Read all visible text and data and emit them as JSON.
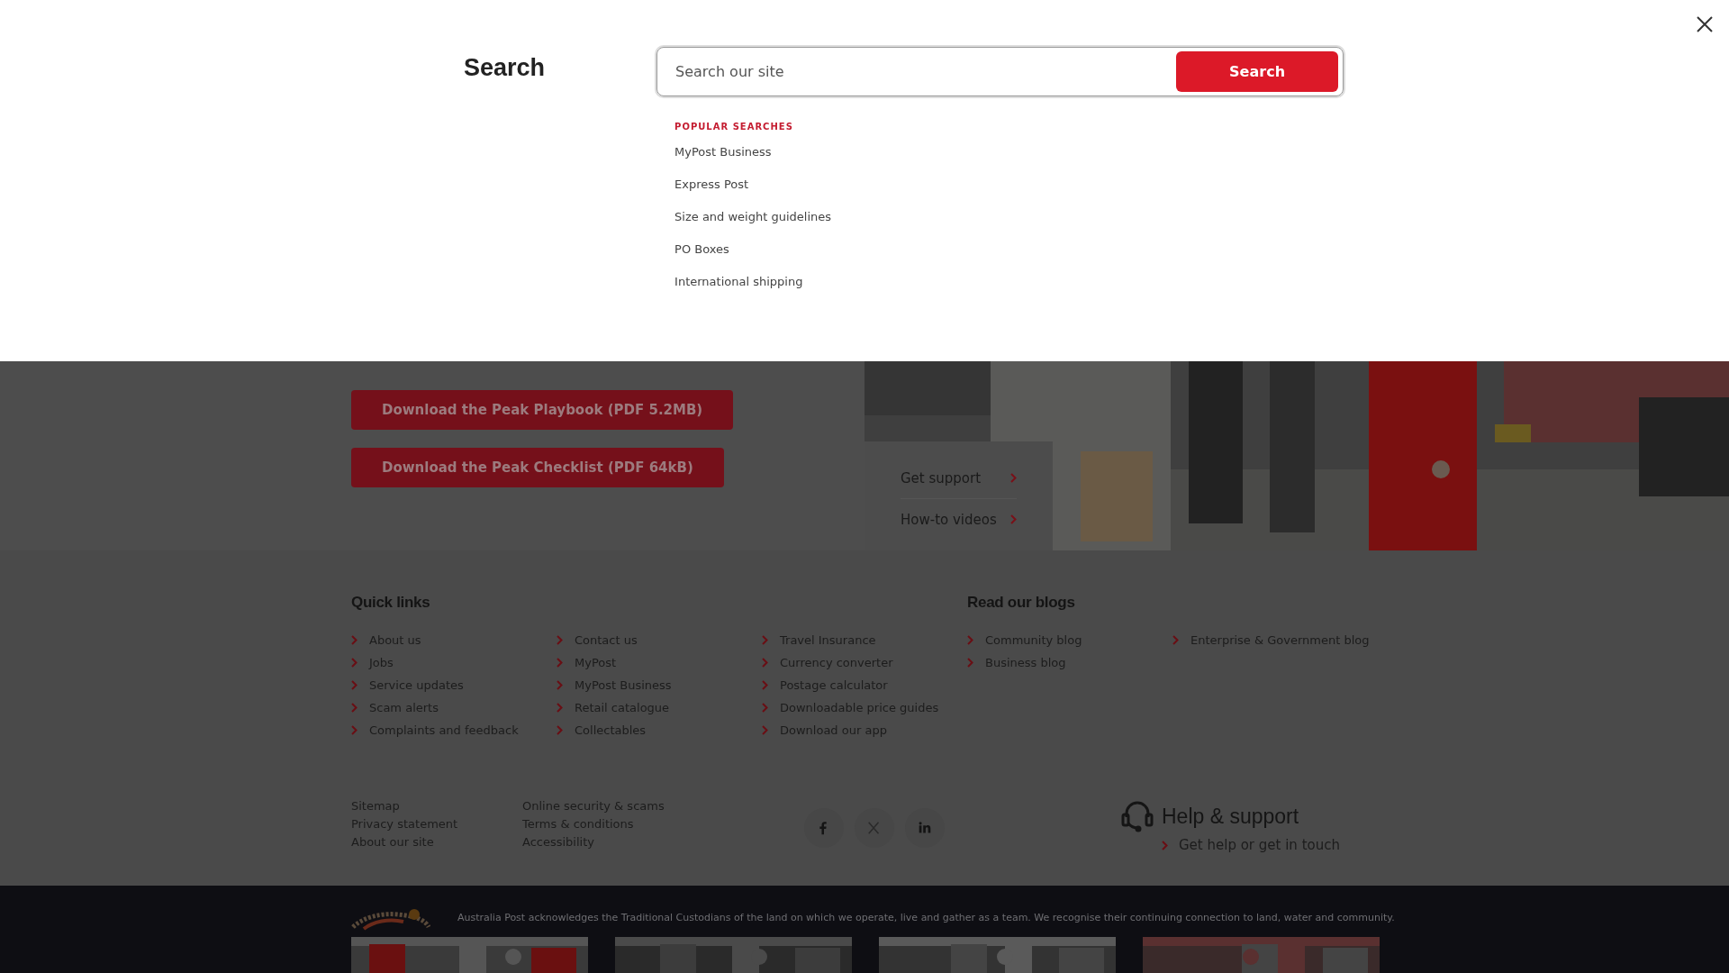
{
  "search": {
    "title": "Search",
    "placeholder": "Search our site",
    "button": "Search",
    "popular_heading": "POPULAR SEARCHES",
    "popular": [
      "MyPost Business",
      "Express Post",
      "Size and weight guidelines",
      "PO Boxes",
      "International shipping"
    ]
  },
  "promo": {
    "buttons": [
      "Download the Peak Playbook (PDF 5.2MB)",
      "Download the Peak Checklist (PDF 64kB)"
    ],
    "support_links": [
      "Get support",
      "How-to videos"
    ],
    "photo": {
      "kind": "picture"
    }
  },
  "quick_links": {
    "title": "Quick links",
    "columns": [
      [
        "About us",
        "Jobs",
        "Service updates",
        "Scam alerts",
        "Complaints and feedback"
      ],
      [
        "Contact us",
        "MyPost",
        "MyPost Business",
        "Retail catalogue",
        "Collectables"
      ],
      [
        "Travel Insurance",
        "Currency converter",
        "Postage calculator",
        "Downloadable price guides",
        "Download our app"
      ]
    ]
  },
  "blogs": {
    "title": "Read our blogs",
    "columns": [
      [
        "Community blog",
        "Business blog"
      ],
      [
        "Enterprise & Government blog"
      ]
    ]
  },
  "legal_links": [
    [
      "Sitemap",
      "Privacy statement",
      "About our site"
    ],
    [
      "Online security & scams",
      "Terms & conditions",
      "Accessibility"
    ]
  ],
  "social": [
    {
      "kind": "facebook"
    },
    {
      "kind": "x"
    },
    {
      "kind": "linkedin"
    }
  ],
  "help": {
    "title": "Help & support",
    "link": "Get help or get in touch"
  },
  "acknowledgement": "Australia Post acknowledges the Traditional Custodians of the land on which we operate, live and gather as a team. We recognise their continuing connection to land, water and community.",
  "gallery": [
    {
      "kind": "picture"
    },
    {
      "kind": "picture"
    },
    {
      "kind": "picture"
    },
    {
      "kind": "picture"
    }
  ]
}
